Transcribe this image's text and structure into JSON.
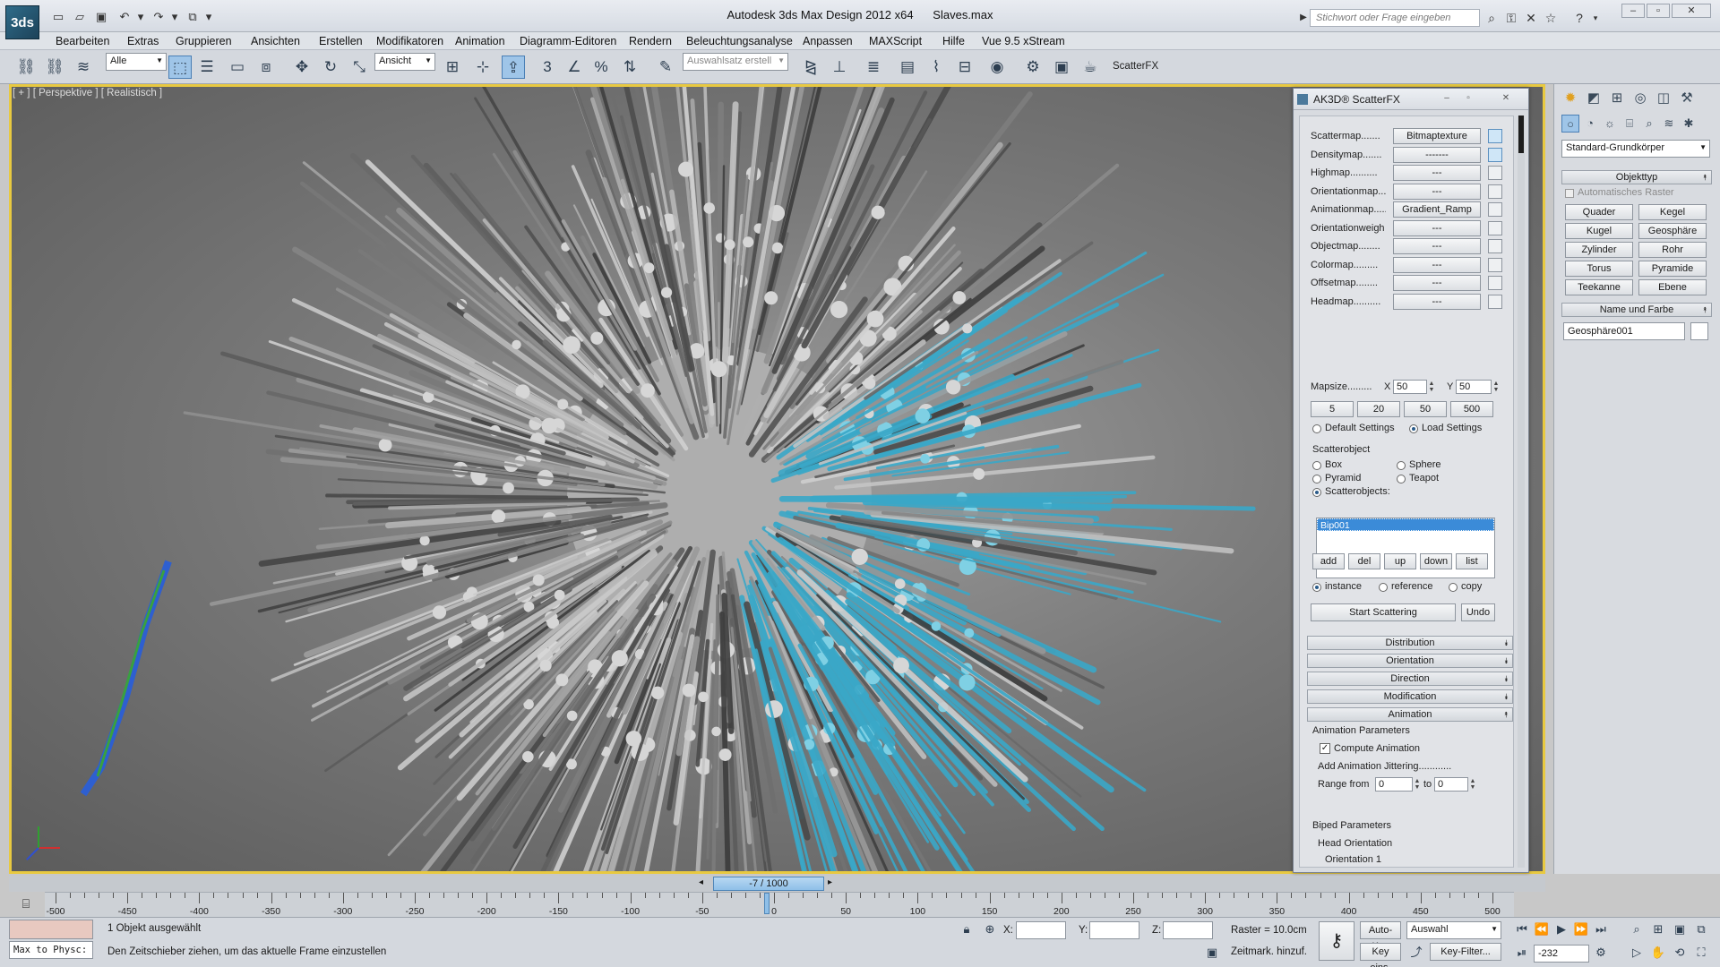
{
  "app": {
    "logo_text": "3ds",
    "window_title": "Autodesk 3ds Max Design 2012 x64",
    "file_name": "Slaves.max",
    "search_placeholder": "Stichwort oder Frage eingeben"
  },
  "menu": [
    "Bearbeiten",
    "Extras",
    "Gruppieren",
    "Ansichten",
    "Erstellen",
    "Modifikatoren",
    "Animation",
    "Diagramm-Editoren",
    "Rendern",
    "Beleuchtungsanalyse",
    "Anpassen",
    "MAXScript",
    "Hilfe",
    "Vue 9.5 xStream"
  ],
  "toolbar": {
    "filter_select": "Alle",
    "coord_select": "Ansicht",
    "selection_set": "Auswahlsatz erstell",
    "scatterfx_label": "ScatterFX"
  },
  "viewport": {
    "label": "[ + ] [ Perspektive ] [ Realistisch ]"
  },
  "scatterfx": {
    "title": "AK3D® ScatterFX",
    "maps": [
      {
        "label": "Scattermap.......",
        "value": "Bitmaptexture",
        "checked": true
      },
      {
        "label": "Densitymap.......",
        "value": "-------",
        "checked": true
      },
      {
        "label": "Highmap..........",
        "value": "---",
        "checked": false
      },
      {
        "label": "Orientationmap...",
        "value": "---",
        "checked": false
      },
      {
        "label": "Animationmap.....",
        "value": "Gradient_Ramp",
        "checked": false
      },
      {
        "label": "Orientationweigh",
        "value": "---",
        "checked": false
      },
      {
        "label": "Objectmap........",
        "value": "---",
        "checked": false
      },
      {
        "label": "Colormap.........",
        "value": "---",
        "checked": false
      },
      {
        "label": "Offsetmap........",
        "value": "---",
        "checked": false
      },
      {
        "label": "Headmap..........",
        "value": "---",
        "checked": false
      }
    ],
    "mapsize_label": "Mapsize.........",
    "mapsize_x_label": "X",
    "mapsize_x": "50",
    "mapsize_y_label": "Y",
    "mapsize_y": "50",
    "presets": [
      "5",
      "20",
      "50",
      "500"
    ],
    "default_settings": "Default Settings",
    "load_settings": "Load Settings",
    "scatterobject_heading": "Scatterobject",
    "obj_box": "Box",
    "obj_sphere": "Sphere",
    "obj_pyramid": "Pyramid",
    "obj_teapot": "Teapot",
    "obj_scatterobjects": "Scatterobjects:",
    "object_list": [
      "Bip001"
    ],
    "list_buttons": [
      "add",
      "del",
      "up",
      "down",
      "list"
    ],
    "mode_instance": "instance",
    "mode_reference": "reference",
    "mode_copy": "copy",
    "start_button": "Start Scattering",
    "undo_button": "Undo",
    "rollouts": [
      "Distribution",
      "Orientation",
      "Direction",
      "Modification",
      "Animation"
    ],
    "anim_params_heading": "Animation Parameters",
    "compute_animation": "Compute Animation",
    "add_jittering": "Add Animation Jittering............",
    "range_from_label": "Range from",
    "range_from": "0",
    "range_to_label": "to",
    "range_to": "0",
    "biped_heading": "Biped Parameters",
    "head_orientation": "Head Orientation",
    "orientation_1": "Orientation 1"
  },
  "command_panel": {
    "category_select": "Standard-Grundkörper",
    "objecttype_rollout": "Objekttyp",
    "auto_grid": "Automatisches Raster",
    "buttons": [
      "Quader",
      "Kegel",
      "Kugel",
      "Geosphäre",
      "Zylinder",
      "Rohr",
      "Torus",
      "Pyramide",
      "Teekanne",
      "Ebene"
    ],
    "name_color_rollout": "Name und Farbe",
    "object_name": "Geosphäre001"
  },
  "timeline": {
    "frame_display": "-7 / 1000",
    "ticks": [
      "-500",
      "-450",
      "-400",
      "-350",
      "-300",
      "-250",
      "-200",
      "-150",
      "-100",
      "-50",
      "0",
      "50",
      "100",
      "150",
      "200",
      "250",
      "300",
      "350",
      "400",
      "450",
      "500"
    ]
  },
  "status": {
    "maxscript_listener": "Max to Physc:",
    "selection_status": "1 Objekt ausgewählt",
    "prompt": "Den Zeitschieber ziehen, um das aktuelle Frame einzustellen",
    "x_label": "X:",
    "y_label": "Y:",
    "z_label": "Z:",
    "grid": "Raster = 10.0cm",
    "time_tag": "Zeitmark. hinzuf.",
    "auto_key": "Auto-Key",
    "set_key": "Key eins.",
    "selection_select": "Auswahl",
    "key_filters": "Key-Filter...",
    "current_frame": "-232"
  },
  "colors": {
    "viewport_border": "#e8c940",
    "selection_blue": "#3b8bd8",
    "scatter_teal": "#3aa8c8"
  }
}
